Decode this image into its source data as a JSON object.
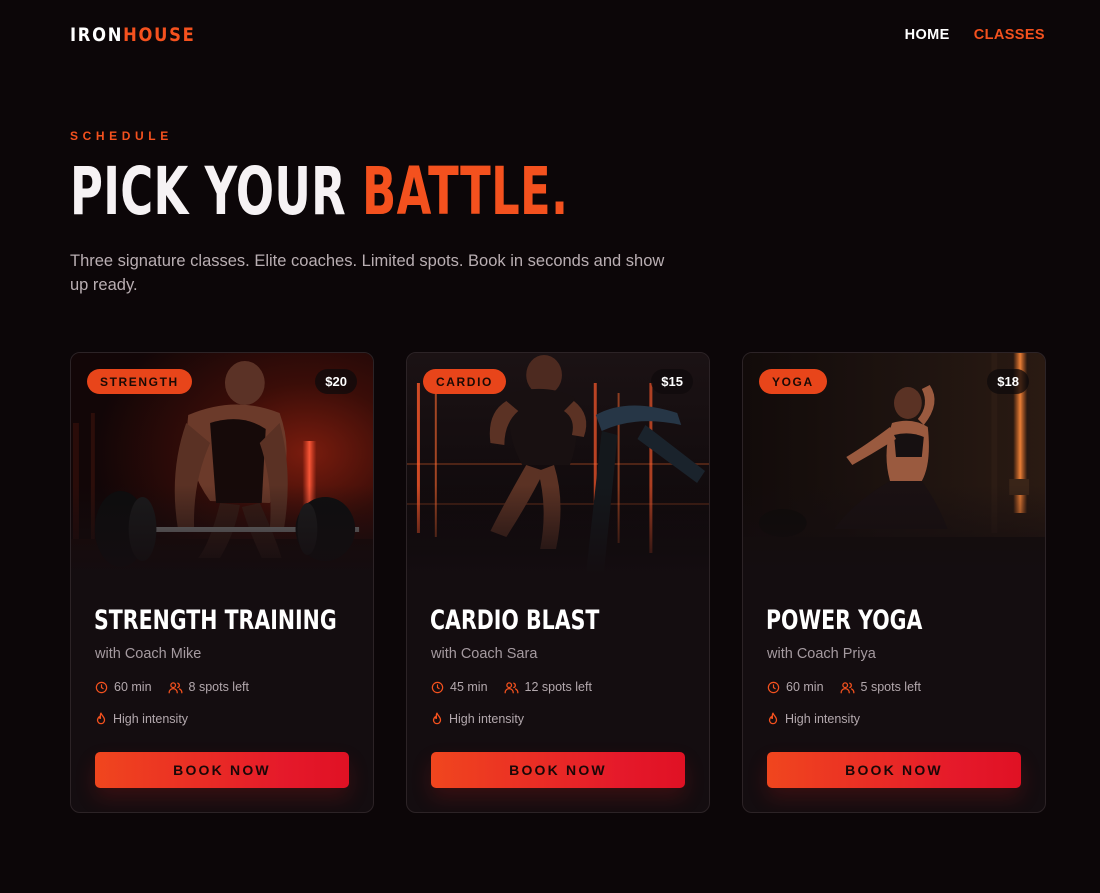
{
  "brand": {
    "part1": "IRON",
    "part2": "HOUSE"
  },
  "nav": {
    "home": "HOME",
    "classes": "CLASSES"
  },
  "hero": {
    "eyebrow": "SCHEDULE",
    "title_main": "PICK YOUR ",
    "title_accent": "BATTLE.",
    "lead": "Three signature classes. Elite coaches. Limited spots. Book in seconds and show up ready."
  },
  "colors": {
    "accent": "#f4511e",
    "button_end": "#e01124",
    "background": "#0c0608"
  },
  "classes": [
    {
      "tag": "STRENGTH",
      "price": "$20",
      "name": "STRENGTH TRAINING",
      "coach": "with Coach Mike",
      "duration": "60 min",
      "spots": "8 spots left",
      "intensity": "High intensity",
      "cta": "BOOK NOW",
      "image": "deadlift-photo"
    },
    {
      "tag": "CARDIO",
      "price": "$15",
      "name": "CARDIO BLAST",
      "coach": "with Coach Sara",
      "duration": "45 min",
      "spots": "12 spots left",
      "intensity": "High intensity",
      "cta": "BOOK NOW",
      "image": "treadmill-run-photo"
    },
    {
      "tag": "YOGA",
      "price": "$18",
      "name": "POWER YOGA",
      "coach": "with Coach Priya",
      "duration": "60 min",
      "spots": "5 spots left",
      "intensity": "High intensity",
      "cta": "BOOK NOW",
      "image": "yoga-pose-photo"
    }
  ]
}
